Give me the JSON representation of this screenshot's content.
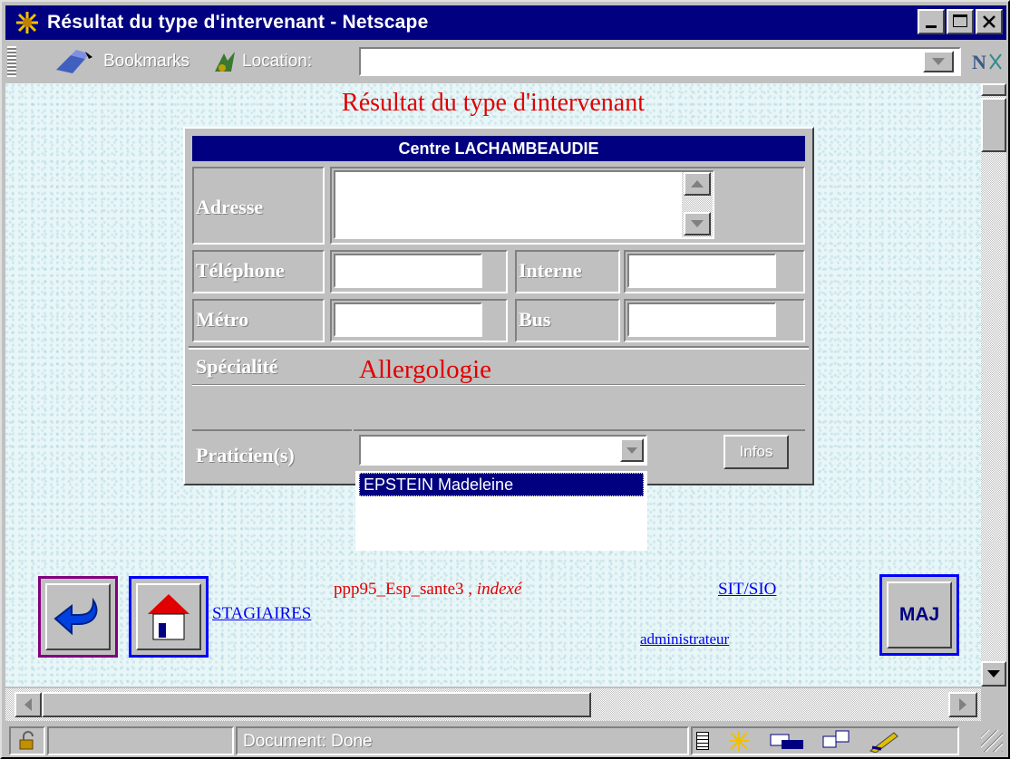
{
  "window": {
    "title": "Résultat du type d'intervenant - Netscape"
  },
  "toolbar": {
    "bookmarks_label": "Bookmarks",
    "location_label": "Location:",
    "location_value": ""
  },
  "page": {
    "title": "Résultat du type d'intervenant",
    "center_name": "Centre LACHAMBEAUDIE",
    "fields": {
      "adresse_label": "Adresse",
      "telephone_label": "Téléphone",
      "interne_label": "Interne",
      "metro_label": "Métro",
      "bus_label": "Bus",
      "specialite_label": "Spécialité",
      "praticiens_label": "Praticien(s)"
    },
    "specialite_value": "Allergologie",
    "praticien_selected": "",
    "praticien_options": [
      "EPSTEIN Madeleine"
    ],
    "infos_button": "Infos"
  },
  "footer": {
    "doc_name": "ppp95_Esp_sante3",
    "doc_sep": " , ",
    "doc_state": "indexé",
    "link_sit": "SIT/SIO",
    "link_stagiaires": "STAGIAIRES",
    "link_admin": "administrateur",
    "maj_button": "MAJ"
  },
  "status": {
    "text": "Document: Done"
  },
  "colors": {
    "title_bar": "#000080",
    "page_title": "#e00000",
    "link": "#0000ee",
    "back_button_border": "#800080",
    "home_button_border": "#0000ff"
  }
}
